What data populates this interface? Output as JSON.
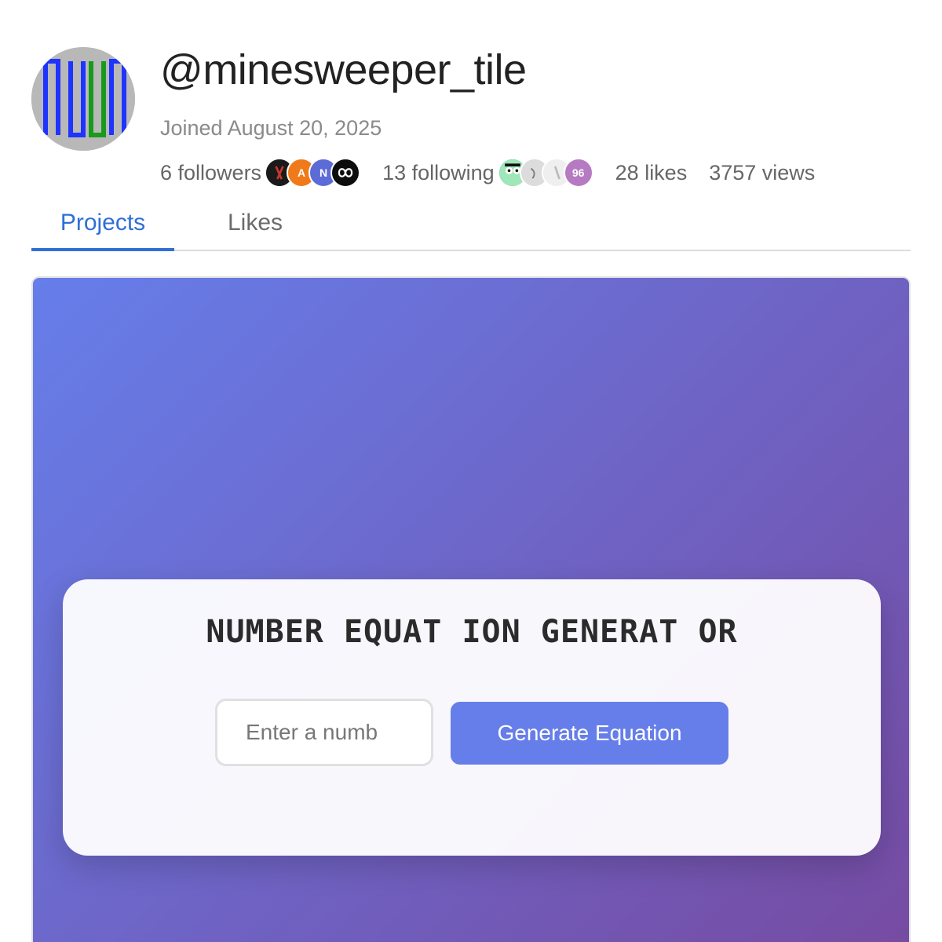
{
  "profile": {
    "username": "@minesweeper_tile",
    "joined": "Joined August 20, 2025",
    "followers_label": "6 followers",
    "following_label": "13 following",
    "likes_label": "28 likes",
    "views_label": "3757 views",
    "followers_avatars": [
      {
        "icon": "dark-avatar-icon"
      },
      {
        "icon": "orange-letter-a-avatar-icon",
        "text": "A"
      },
      {
        "icon": "purple-letter-n-avatar-icon",
        "text": "N"
      },
      {
        "icon": "infinity-avatar-icon"
      }
    ],
    "following_avatars": [
      {
        "icon": "cartoon-avatar-icon"
      },
      {
        "icon": "grey-face-avatar-icon"
      },
      {
        "icon": "light-grey-avatar-icon"
      },
      {
        "icon": "number-96-avatar-icon",
        "text": "96"
      }
    ]
  },
  "tabs": {
    "projects": "Projects",
    "likes": "Likes"
  },
  "project": {
    "title": "NUMBER EQUAT ION GENERAT OR",
    "input_placeholder": "Enter a numb",
    "button_label": "Generate Equation",
    "gradient_start": "#667eea",
    "gradient_end": "#764ba2"
  }
}
